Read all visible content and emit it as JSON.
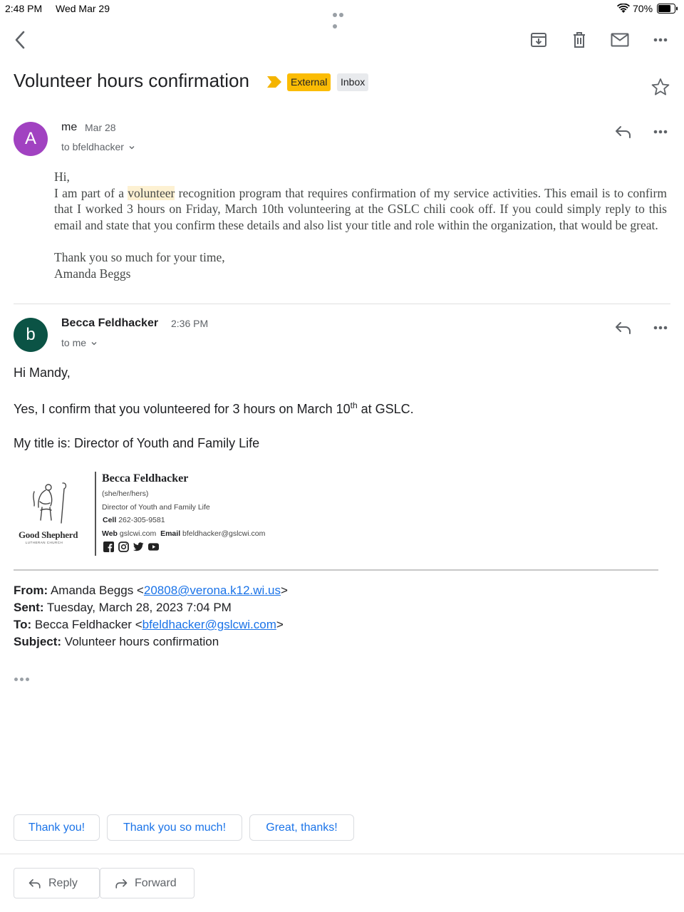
{
  "status_bar": {
    "time": "2:48 PM",
    "date": "Wed Mar 29",
    "battery": "70%"
  },
  "email": {
    "subject": "Volunteer hours confirmation",
    "labels": [
      "External",
      "Inbox"
    ]
  },
  "message1": {
    "avatar_letter": "A",
    "avatar_color": "#a142c1",
    "sender": "me",
    "date": "Mar 28",
    "recipient": "to bfeldhacker",
    "greeting": "Hi,",
    "body_pre": "I am part of a ",
    "body_highlight": "volunteer",
    "body_post": " recognition program that requires confirmation of my service activities. This email is to confirm that I worked 3 hours on Friday, March 10th volunteering at the GSLC chili cook off. If you could simply reply to this email and state that you confirm these details and also list your title and role within the organization, that would be great.",
    "closing": "Thank you so much for your time,",
    "signature": "Amanda Beggs"
  },
  "message2": {
    "avatar_letter": "b",
    "avatar_color": "#0b5345",
    "sender": "Becca Feldhacker",
    "date": "2:36 PM",
    "recipient": "to me",
    "greeting": "Hi Mandy,",
    "line1_pre": "Yes, I confirm that you volunteered for 3 hours on March 10",
    "line1_sup": "th",
    "line1_post": " at GSLC.",
    "line2": "My title is: Director of Youth and Family Life"
  },
  "sig": {
    "logo_text": "Good Shepherd",
    "logo_sub": "LUTHERAN CHURCH",
    "name": "Becca Feldhacker",
    "pronouns": "(she/her/hers)",
    "title": "Director of Youth and Family Life",
    "cell_label": "Cell",
    "cell": "262-305-9581",
    "web_label": "Web",
    "web": "gslcwi.com",
    "email_label": "Email",
    "email": "bfeldhacker@gslcwi.com"
  },
  "quoted": {
    "from_label": "From:",
    "from_name": "Amanda Beggs <",
    "from_email": "20808@verona.k12.wi.us",
    "from_close": ">",
    "sent_label": "Sent:",
    "sent": "Tuesday, March 28, 2023 7:04 PM",
    "to_label": "To:",
    "to_name": "Becca Feldhacker <",
    "to_email": "bfeldhacker@gslcwi.com",
    "to_close": ">",
    "subject_label": "Subject:",
    "subject": "Volunteer hours confirmation"
  },
  "smart_replies": [
    "Thank you!",
    "Thank you so much!",
    "Great, thanks!"
  ],
  "actions": {
    "reply": "Reply",
    "forward": "Forward"
  },
  "colors": {
    "accent": "#1a73e8",
    "external_label": "#fbbc04",
    "importance": "#f4b400"
  }
}
